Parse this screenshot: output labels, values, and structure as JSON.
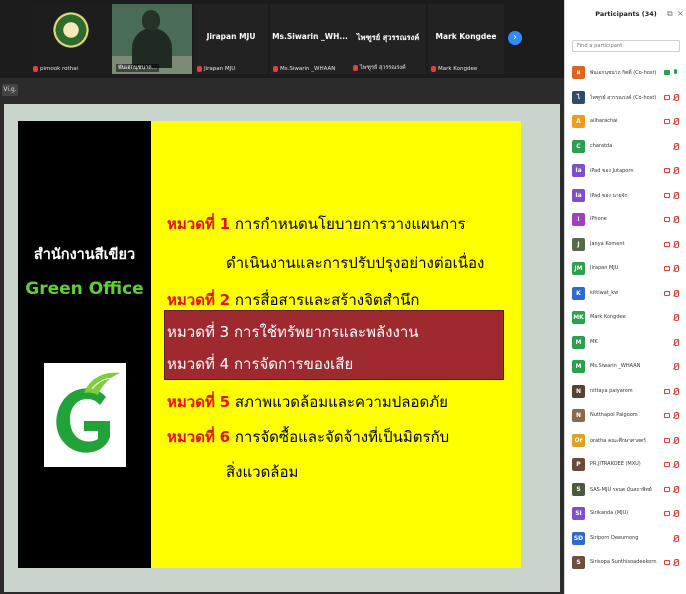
{
  "filmstrip": {
    "tiles": [
      {
        "name": "",
        "caption": "pimook rothai",
        "kind": "logo"
      },
      {
        "name": "",
        "caption": "พันเอกนุชนาถ...",
        "kind": "video"
      },
      {
        "name": "Jirapan  MJU",
        "caption": "Jirapan  MJU"
      },
      {
        "name": "Ms.Siwarin _WH...",
        "caption": "Ms.Siwarin _WHAAN"
      },
      {
        "name": "ไพฑูรย์ สุวรรณรงค์",
        "caption": "ไพฑูรย์ สุวรรณรงค์"
      },
      {
        "name": "Mark Kongdee",
        "caption": "Mark Kongdee"
      }
    ],
    "next_icon": "chevron-right-icon",
    "view_label": "Vi.g."
  },
  "slide": {
    "office_th": "สำนักงานสีเขียว",
    "office_en": "Green Office",
    "logo_letter": "G",
    "categories": [
      {
        "keyword": "หมวดที่",
        "number": "1",
        "text": "การกำหนดนโยบายการวางแผนการ",
        "cont": "ดำเนินงานและการปรับปรุงอย่างต่อเนื่อง"
      },
      {
        "keyword": "หมวดที่",
        "number": "2",
        "text": "การสื่อสารและสร้างจิตสำนึก"
      },
      {
        "keyword": "หมวดที่",
        "number": "3",
        "text": "การใช้ทรัพยากรและพลังงาน"
      },
      {
        "keyword": "หมวดที่",
        "number": "4",
        "text": "การจัดการของเสีย"
      },
      {
        "keyword": "หมวดที่",
        "number": "5",
        "text": "สภาพแวดล้อมและความปลอดภัย"
      },
      {
        "keyword": "หมวดที่",
        "number": "6",
        "text": "การจัดซื้อและจัดจ้างที่เป็นมิตรกับ",
        "cont": "สิ่งแวดล้อม"
      }
    ],
    "colors": {
      "left_bg": "#000000",
      "right_bg": "#ffff00",
      "keyword": "#e8101a",
      "highlight": "#9e2a30",
      "green_text": "#5cd12f"
    }
  },
  "panel": {
    "title": "Participants (34)",
    "popout_icon": "popout-icon",
    "close_icon": "close-icon",
    "search_placeholder": "Find a participant",
    "participants": [
      {
        "initial": "ผ",
        "name": "พันเอกนุชนาถ กิตติ์ (Co-host)",
        "color": "#e0641e",
        "mic": "on",
        "cam": "on"
      },
      {
        "initial": "ไ",
        "name": "ไพฑูรย์ สุวรรณรงค์ (Co-host)",
        "color": "#2f4a6b",
        "mic": "muted",
        "cam": "off"
      },
      {
        "initial": "A",
        "name": "aiiharachai",
        "color": "#f29a1c",
        "mic": "muted",
        "cam": "off"
      },
      {
        "initial": "C",
        "name": "charatda",
        "color": "#2aa14a",
        "mic": "muted",
        "cam": "none"
      },
      {
        "initial": "Ia",
        "name": "iPad ของ Jutaporn",
        "color": "#7b4fcf",
        "mic": "muted",
        "cam": "off"
      },
      {
        "initial": "Ia",
        "name": "iPad ของ นายจัก",
        "color": "#7b4fcf",
        "mic": "muted",
        "cam": "off"
      },
      {
        "initial": "I",
        "name": "iPhone",
        "color": "#a03fc2",
        "mic": "muted",
        "cam": "off"
      },
      {
        "initial": "J",
        "name": "Janya Koment",
        "color": "#556b4a",
        "mic": "muted",
        "cam": "off"
      },
      {
        "initial": "JM",
        "name": "Jirapan  MJU",
        "color": "#2aa14a",
        "mic": "muted",
        "cam": "off"
      },
      {
        "initial": "K",
        "name": "kittiwat_kw",
        "color": "#2e6bd1",
        "mic": "muted",
        "cam": "off"
      },
      {
        "initial": "MK",
        "name": "Mark Kongdee",
        "color": "#2aa14a",
        "mic": "muted",
        "cam": "none"
      },
      {
        "initial": "M",
        "name": "MK",
        "color": "#2aa14a",
        "mic": "muted",
        "cam": "none"
      },
      {
        "initial": "M",
        "name": "Ms.Siwarin _WHAAN",
        "color": "#2aa14a",
        "mic": "muted",
        "cam": "none"
      },
      {
        "initial": "N",
        "name": "nittaya paiyarom",
        "color": "#5a4030",
        "mic": "muted",
        "cam": "off"
      },
      {
        "initial": "N",
        "name": "Nutthapol Palgoom",
        "color": "#8a6a4a",
        "mic": "muted",
        "cam": "off"
      },
      {
        "initial": "Or",
        "name": "oratha คณะศึกษาศาสตร์",
        "color": "#e0a21e",
        "mic": "muted",
        "cam": "off"
      },
      {
        "initial": "P",
        "name": "PR.JITRAKOEE (MXU)",
        "color": "#6b4a3a",
        "mic": "muted",
        "cam": "off"
      },
      {
        "initial": "S",
        "name": "SAS-MJU รจนต มั่นสถาพิทย์",
        "color": "#4a5a3a",
        "mic": "muted",
        "cam": "off"
      },
      {
        "initial": "SI",
        "name": "Sirikanda (MJU)",
        "color": "#7b4fcf",
        "mic": "muted",
        "cam": "off"
      },
      {
        "initial": "SD",
        "name": "Siriporn  Deeumong",
        "color": "#2e6bd1",
        "mic": "muted",
        "cam": "none"
      },
      {
        "initial": "S",
        "name": "Sirisopa Sunthisoadeekorn",
        "color": "#6b5040",
        "mic": "muted",
        "cam": "off"
      }
    ]
  }
}
